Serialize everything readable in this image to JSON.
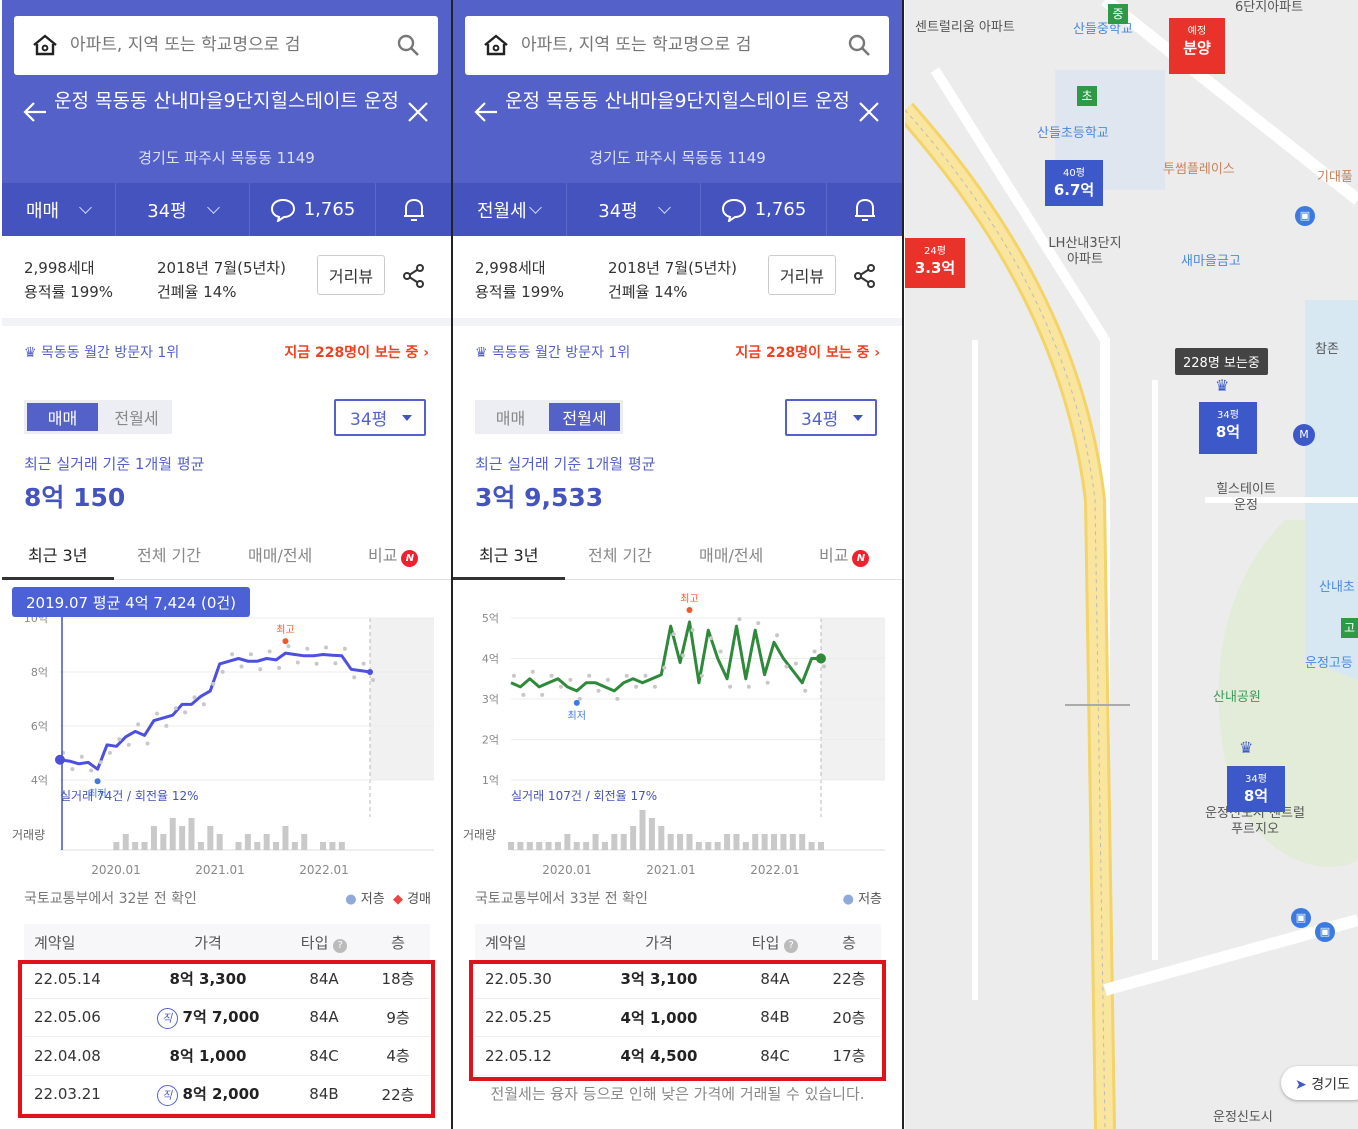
{
  "search_placeholder": "아파트, 지역 또는 학교명으로 검",
  "complex_title": "운정 목동동 산내마을9단지힐스테이트 운정",
  "address": "경기도 파주시 목동동 1149",
  "panels": [
    {
      "deal_type": "매매",
      "size": "34평",
      "comments": "1,765",
      "households": "2,998세대",
      "floor_area_ratio": "용적률 199%",
      "built": "2018년 7월(5년차)",
      "coverage_ratio": "건폐율 14%",
      "street_view": "거리뷰",
      "rank_text": "목동동 월간 방문자 1위",
      "viewers_text": "지금 228명이 보는 중",
      "seg_left": "매매",
      "seg_right": "전월세",
      "seg_selected": "left",
      "size_select": "34평",
      "avg_label": "최근 실거래 기준 1개월 평균",
      "avg_value": "8억 150",
      "period_tabs": [
        "최근 3년",
        "전체 기간",
        "매매/전세",
        "비교"
      ],
      "new_badge": "N",
      "update_note": "국토교통부에서 32분 전 확인",
      "legend": [
        "저층",
        "경매"
      ],
      "table_headers": [
        "계약일",
        "가격",
        "타입",
        "층"
      ],
      "rows": [
        {
          "date": "22.05.14",
          "price": "8억 3,300",
          "direct": false,
          "type": "84A",
          "floor": "18층"
        },
        {
          "date": "22.05.06",
          "price": "7억 7,000",
          "direct": true,
          "type": "84A",
          "floor": "9층"
        },
        {
          "date": "22.04.08",
          "price": "8억 1,000",
          "direct": false,
          "type": "84C",
          "floor": "4층"
        },
        {
          "date": "22.03.21",
          "price": "8억 2,000",
          "direct": true,
          "type": "84B",
          "floor": "22층"
        }
      ],
      "direct_mark": "직",
      "footer": ""
    },
    {
      "deal_type": "전월세",
      "size": "34평",
      "comments": "1,765",
      "households": "2,998세대",
      "floor_area_ratio": "용적률 199%",
      "built": "2018년 7월(5년차)",
      "coverage_ratio": "건폐율 14%",
      "street_view": "거리뷰",
      "rank_text": "목동동 월간 방문자 1위",
      "viewers_text": "지금 228명이 보는 중",
      "seg_left": "매매",
      "seg_right": "전월세",
      "seg_selected": "right",
      "size_select": "34평",
      "avg_label": "최근 실거래 기준 1개월 평균",
      "avg_value": "3억 9,533",
      "period_tabs": [
        "최근 3년",
        "전체 기간",
        "매매/전세",
        "비교"
      ],
      "new_badge": "N",
      "update_note": "국토교통부에서 33분 전 확인",
      "legend": [
        "저층"
      ],
      "table_headers": [
        "계약일",
        "가격",
        "타입",
        "층"
      ],
      "rows": [
        {
          "date": "22.05.30",
          "price": "3억 3,100",
          "direct": false,
          "type": "84A",
          "floor": "22층"
        },
        {
          "date": "22.05.25",
          "price": "4억 1,000",
          "direct": false,
          "type": "84B",
          "floor": "20층"
        },
        {
          "date": "22.05.12",
          "price": "4억 4,500",
          "direct": false,
          "type": "84C",
          "floor": "17층"
        }
      ],
      "direct_mark": "",
      "footer": "전월세는 융자 등으로 인해 낮은 가격에 거래될 수 있습니다."
    }
  ],
  "chart_data": [
    {
      "type": "line",
      "x_ticks": [
        "2020.01",
        "2021.01",
        "2022.01"
      ],
      "y_ticks": [
        "4억",
        "6억",
        "8억",
        "10억"
      ],
      "ylim": [
        4,
        10
      ],
      "tooltip": "2019.07 평균 4억 7,424 (0건)",
      "high_label": "최고",
      "low_label": "최저",
      "trade_count": "실거래 74건 / 회전율 12%",
      "volume_label": "거래량",
      "color": "#4c4fe0",
      "avg_series": [
        4.75,
        4.7,
        4.6,
        4.65,
        4.4,
        5.3,
        5.25,
        5.6,
        5.8,
        5.65,
        6.2,
        6.3,
        6.4,
        6.8,
        6.8,
        7.1,
        7.3,
        8.3,
        8.4,
        8.5,
        8.4,
        8.4,
        8.5,
        8.45,
        8.7,
        8.65,
        8.6,
        8.6,
        8.65,
        8.62,
        8.6,
        8.1,
        8.05,
        8.0
      ],
      "volume": [
        0,
        0,
        0,
        0,
        0,
        0,
        1,
        2,
        1,
        1,
        3,
        2,
        4,
        3,
        4,
        1,
        3,
        2,
        0,
        1,
        2,
        1,
        2,
        1,
        3,
        1,
        2,
        0,
        1,
        1,
        1,
        0,
        0,
        0
      ]
    },
    {
      "type": "line",
      "x_ticks": [
        "2020.01",
        "2021.01",
        "2022.01"
      ],
      "y_ticks": [
        "1억",
        "2억",
        "3억",
        "4억",
        "5억"
      ],
      "ylim": [
        1,
        5
      ],
      "high_label": "최고",
      "low_label": "최저",
      "trade_count": "실거래 107건 / 회전율 17%",
      "volume_label": "거래량",
      "color": "#2e8a3a",
      "avg_series": [
        3.4,
        3.3,
        3.5,
        3.3,
        3.4,
        3.5,
        3.3,
        3.2,
        3.4,
        3.4,
        3.3,
        3.2,
        3.4,
        3.5,
        3.4,
        3.5,
        3.6,
        4.8,
        3.9,
        4.9,
        3.4,
        4.7,
        4.0,
        3.5,
        4.8,
        3.5,
        4.7,
        3.6,
        4.4,
        4.0,
        3.7,
        3.4,
        4.0,
        4.0
      ],
      "volume": [
        1,
        1,
        1,
        1,
        1,
        1,
        2,
        1,
        1,
        2,
        1,
        2,
        2,
        3,
        5,
        4,
        3,
        2,
        2,
        2,
        1,
        1,
        1,
        2,
        2,
        1,
        2,
        2,
        2,
        2,
        2,
        2,
        1,
        1
      ]
    }
  ],
  "map": {
    "labels": [
      "센트럴리움 아파트",
      "산들중학교",
      "6단지아파트",
      "산들초등학교",
      "투썸플레이스",
      "기대풀",
      "LH산내3단지 아파트",
      "새마을금고",
      "참존",
      "힐스테이트 운정",
      "산내초",
      "운정고등",
      "산내공원",
      "운정신도시 센트럴푸르지오",
      "경기도",
      "운정신도시"
    ],
    "markers": [
      {
        "size": "40평",
        "price": "6.7억",
        "color": "#3d58c8"
      },
      {
        "size": "24평",
        "price": "3.3억",
        "color": "#e8322a"
      },
      {
        "size": "34평",
        "price": "8억",
        "color": "#3d58c8"
      },
      {
        "size": "34평",
        "price": "8억",
        "color": "#3d58c8"
      },
      {
        "size": "예정",
        "price": "분양",
        "color": "#e8322a"
      }
    ],
    "viewing_badge": "228명 보는중",
    "school_badges": [
      "중",
      "초",
      "고"
    ]
  }
}
